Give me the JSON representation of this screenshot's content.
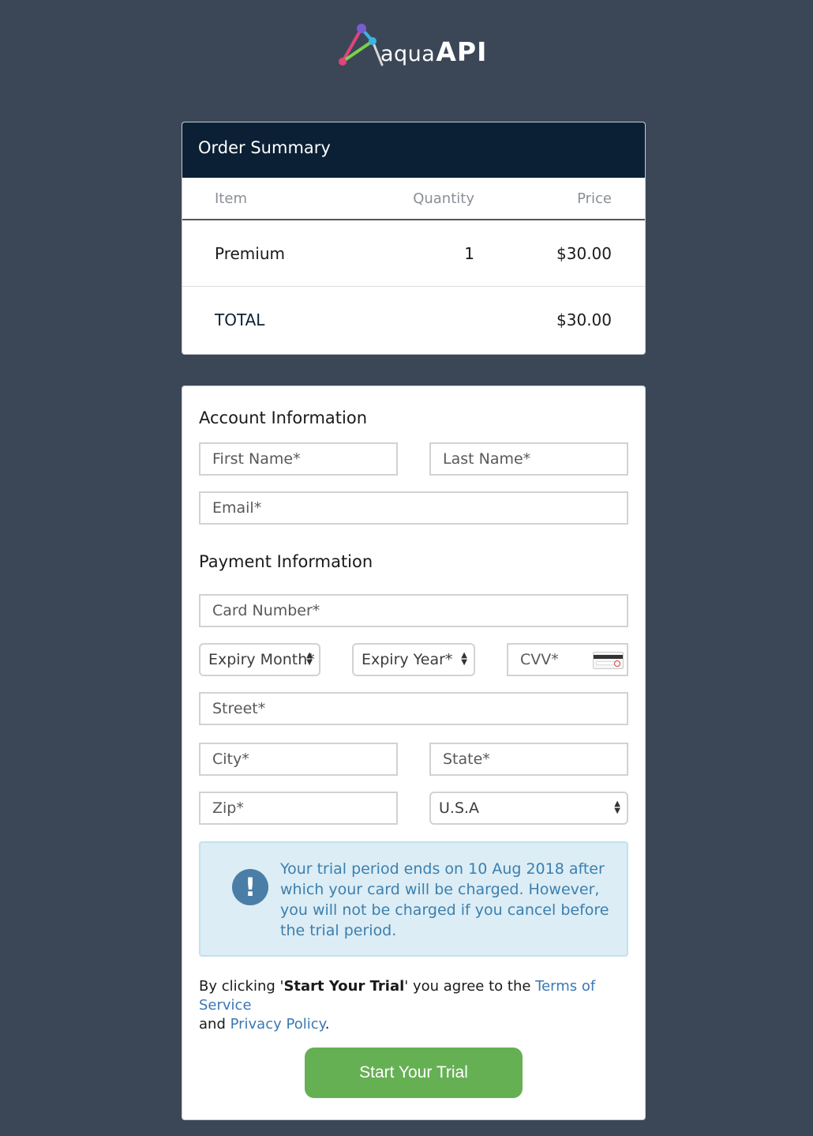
{
  "brand": {
    "logo_part1": "aqua",
    "logo_part2": "API"
  },
  "order_summary": {
    "title": "Order Summary",
    "columns": {
      "item": "Item",
      "quantity": "Quantity",
      "price": "Price"
    },
    "rows": [
      {
        "item": "Premium",
        "quantity": "1",
        "price": "$30.00"
      }
    ],
    "total_label": "TOTAL",
    "total_value": "$30.00"
  },
  "account": {
    "title": "Account Information",
    "first_name_placeholder": "First Name*",
    "last_name_placeholder": "Last Name*",
    "email_placeholder": "Email*"
  },
  "payment": {
    "title": "Payment Information",
    "card_number_placeholder": "Card Number*",
    "expiry_month": "Expiry Month*",
    "expiry_year": "Expiry Year*",
    "cvv_placeholder": "CVV*",
    "street_placeholder": "Street*",
    "city_placeholder": "City*",
    "state_placeholder": "State*",
    "zip_placeholder": "Zip*",
    "country": "U.S.A"
  },
  "alert": {
    "icon": "exclamation-icon",
    "text": "Your trial period ends on 10 Aug 2018 after which your card will be charged. However, you will not be charged if you cancel before the trial period."
  },
  "terms": {
    "prefix": "By clicking '",
    "button_ref": "Start Your Trial",
    "middle": "' you agree to the ",
    "tos_link": "Terms of Service",
    "and": " and ",
    "privacy_link": "Privacy Policy",
    "end": "."
  },
  "cta": {
    "label": "Start Your Trial"
  },
  "colors": {
    "background": "#3b4757",
    "header": "#0b2035",
    "button": "#66b054",
    "link": "#3a77b5",
    "alert_bg": "#dcedf5"
  }
}
